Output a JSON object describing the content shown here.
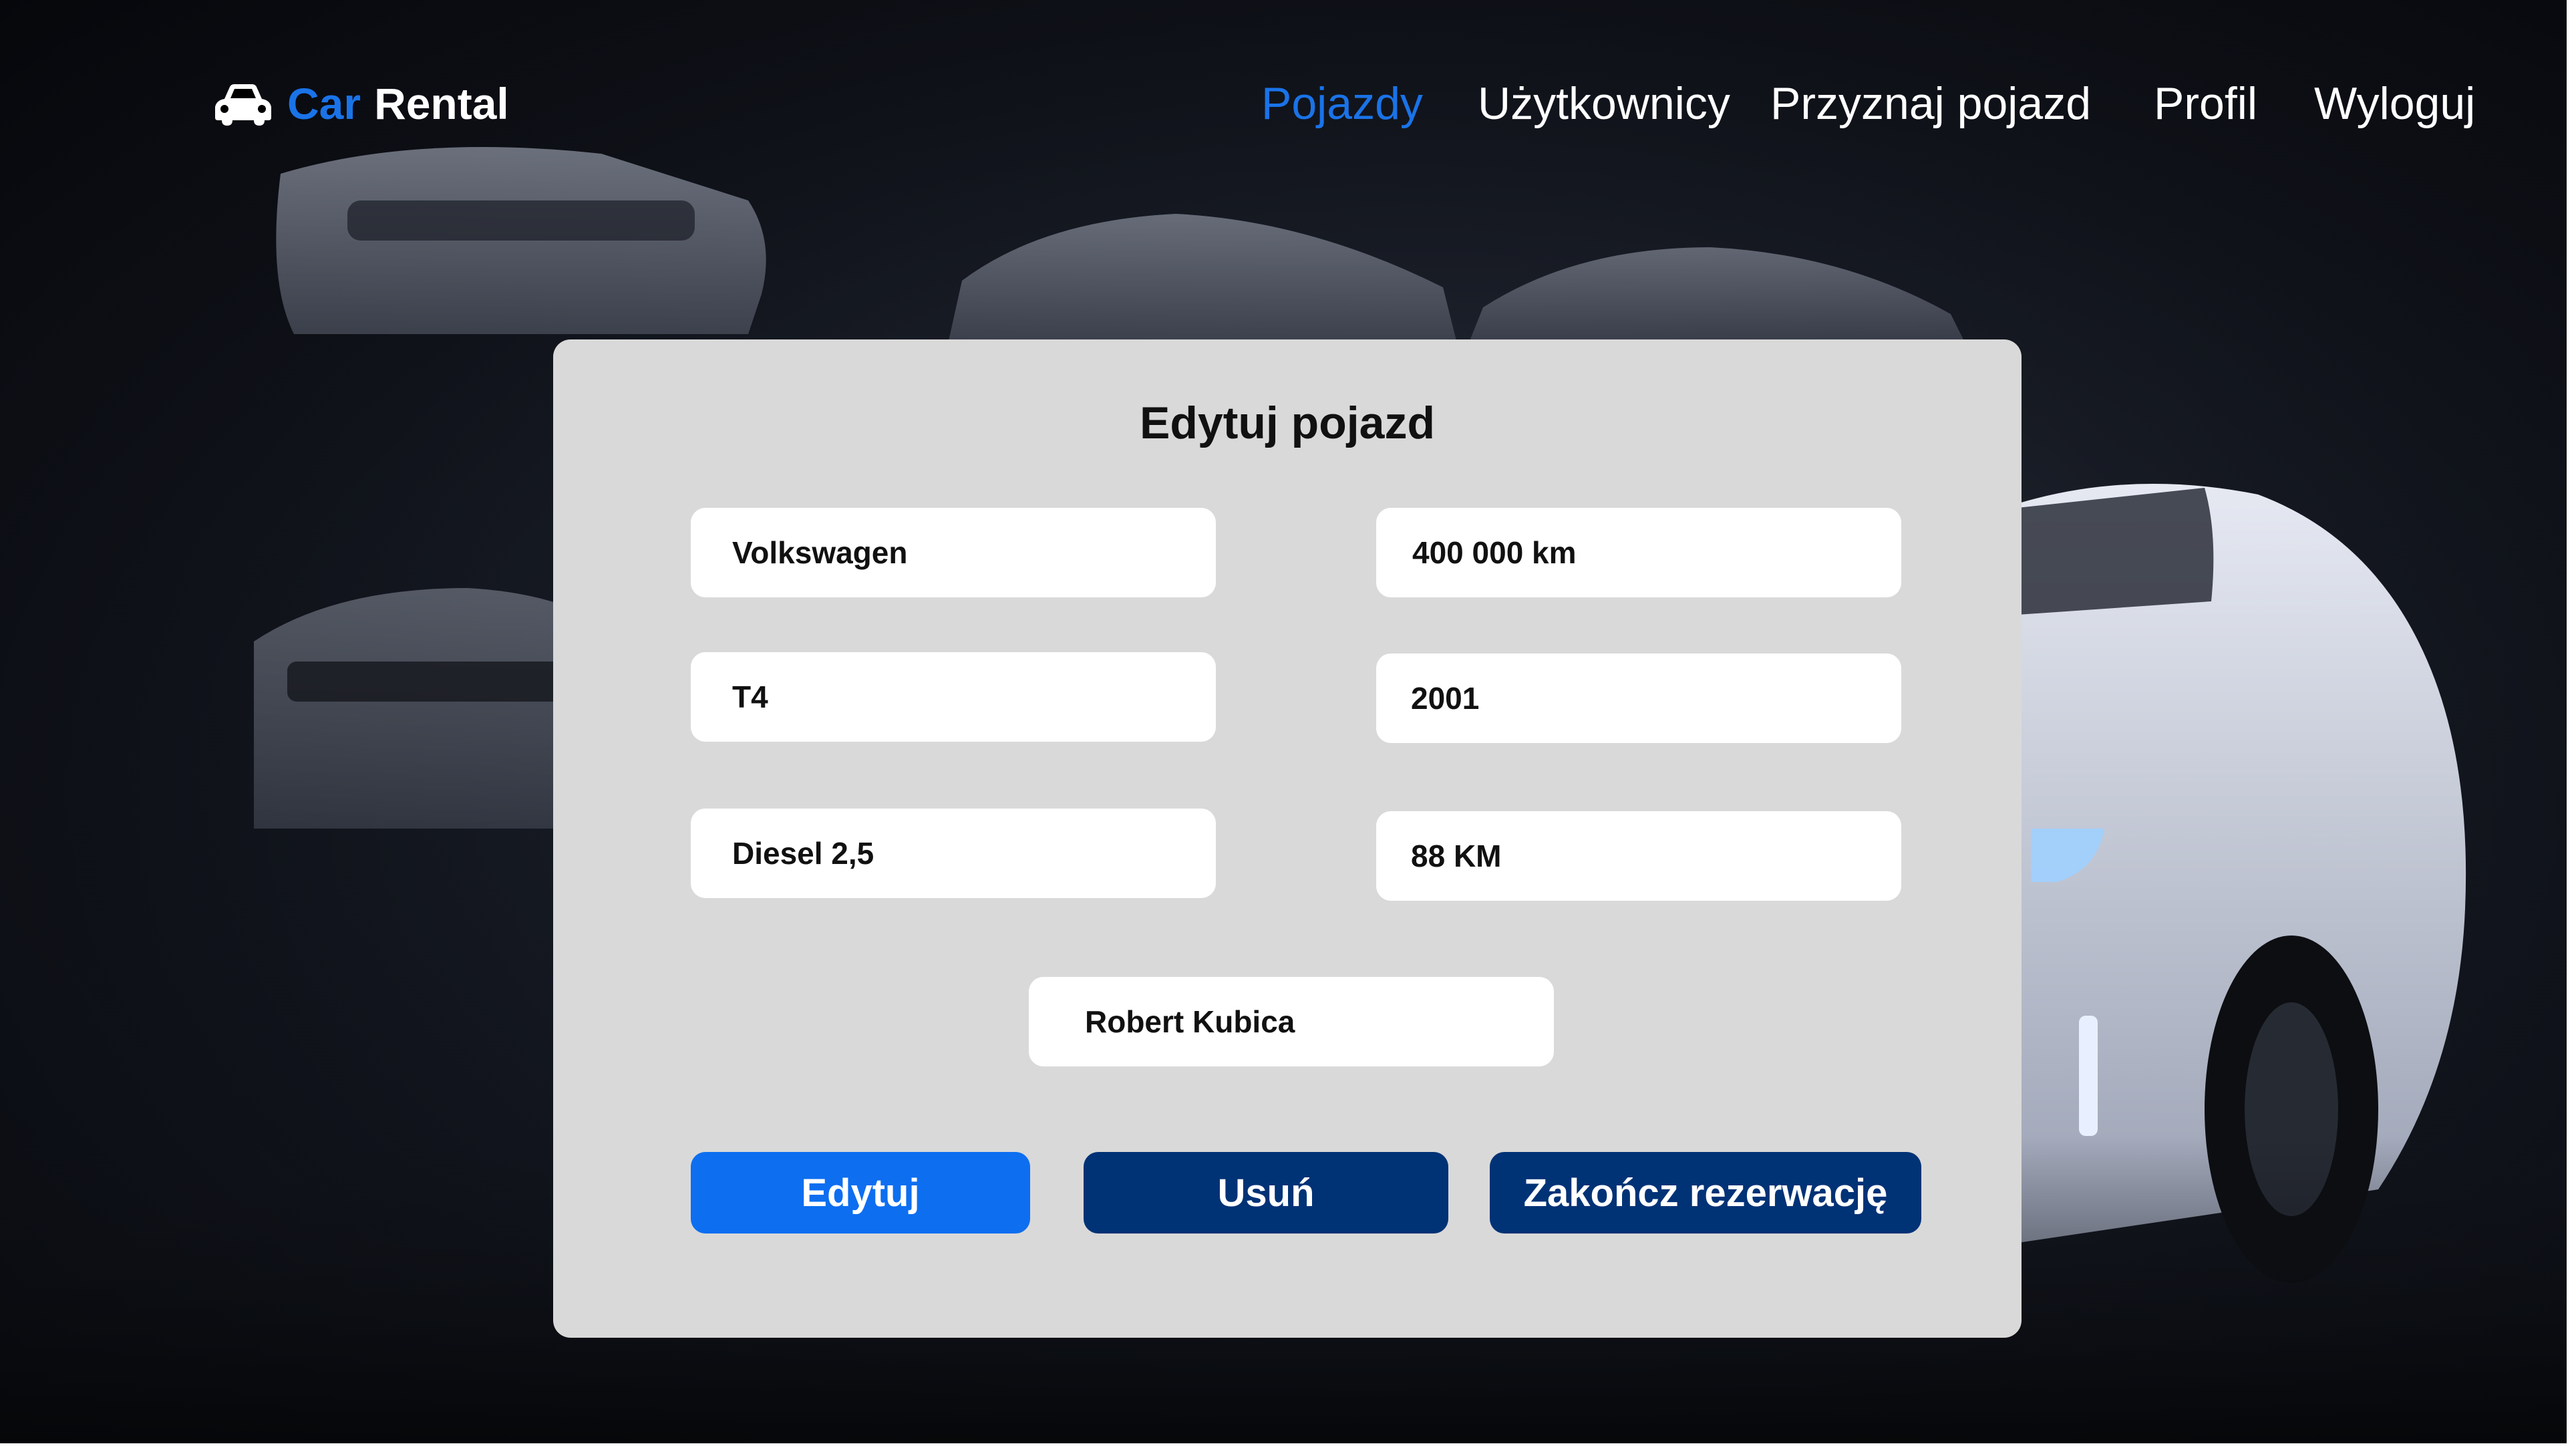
{
  "brand": {
    "icon": "car-icon",
    "word_accent": "Car",
    "word_main": "Rental",
    "accent_color": "#1a73e8"
  },
  "nav": {
    "items": [
      {
        "label": "Pojazdy",
        "active": true
      },
      {
        "label": "Użytkownicy",
        "active": false
      },
      {
        "label": "Przyznaj pojazd",
        "active": false
      },
      {
        "label": "Profil",
        "active": false
      },
      {
        "label": "Wyloguj",
        "active": false
      }
    ]
  },
  "form": {
    "title": "Edytuj pojazd",
    "fields": {
      "brand": "Volkswagen",
      "mileage": "400 000 km",
      "model": "T4",
      "year": "2001",
      "engine": "Diesel 2,5",
      "power": "88 KM",
      "user": "Robert Kubica"
    },
    "buttons": {
      "edit": "Edytuj",
      "delete": "Usuń",
      "end_reservation": "Zakończ rezerwację"
    }
  },
  "colors": {
    "primary": "#0d6ef0",
    "dark": "#003276",
    "card_bg": "#d9d9d9"
  }
}
